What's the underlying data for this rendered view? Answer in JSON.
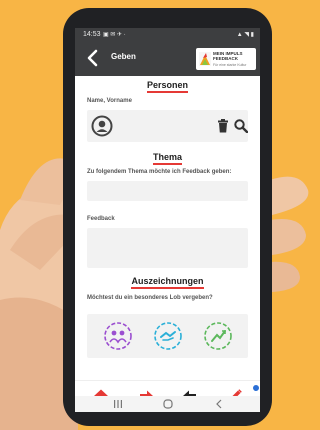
{
  "status": {
    "time": "14:53",
    "left_icons": "▣ ✉ ✈ ·",
    "right_icons": "▲ ◥ ▮"
  },
  "appbar": {
    "title": "Geben"
  },
  "logo": {
    "line1": "MEIN IMPULS",
    "line2": "FEEDBACK",
    "tagline": "Für eine starke Kultur"
  },
  "sections": {
    "personen": {
      "heading": "Personen",
      "label": "Name, Vorname"
    },
    "thema": {
      "heading": "Thema",
      "label": "Zu folgendem Thema möchte ich Feedback geben:"
    },
    "feedback": {
      "label": "Feedback"
    },
    "auszeichnungen": {
      "heading": "Auszeichnungen",
      "label": "Möchtest du ein besonderes Lob vergeben?"
    }
  },
  "awards": [
    {
      "icon": "people-award-icon",
      "color": "#9b4fd0"
    },
    {
      "icon": "handshake-award-icon",
      "color": "#2bb0d8"
    },
    {
      "icon": "growth-award-icon",
      "color": "#5cb85c"
    }
  ],
  "bottom_nav": [
    {
      "icon": "home-icon"
    },
    {
      "icon": "arrow-right-icon"
    },
    {
      "icon": "arrow-left-icon"
    },
    {
      "icon": "pencil-icon"
    }
  ],
  "colors": {
    "accent": "#e53935",
    "appbar": "#3d3e40",
    "background": "#f8b545"
  }
}
